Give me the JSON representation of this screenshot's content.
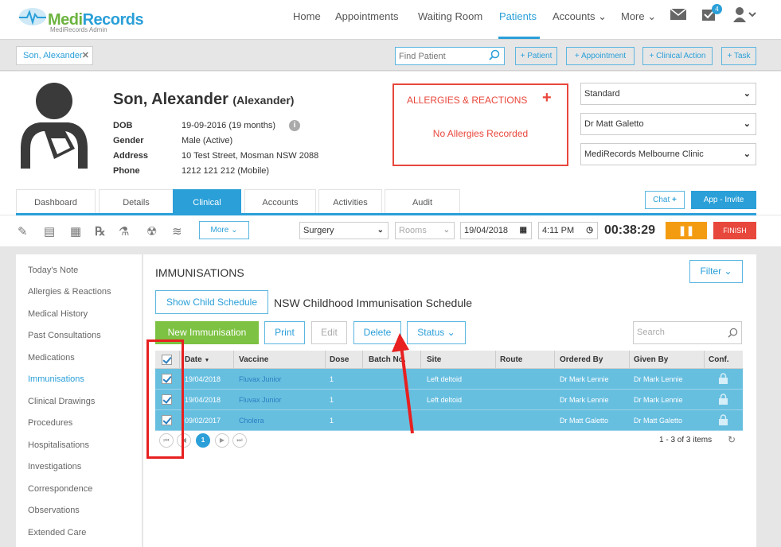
{
  "app": {
    "logo_primary": "Medi",
    "logo_secondary": "Records",
    "logo_sub": "MediRecords Admin"
  },
  "nav": {
    "items": [
      {
        "label": "Home"
      },
      {
        "label": "Appointments"
      },
      {
        "label": "Waiting Room"
      },
      {
        "label": "Patients"
      },
      {
        "label": "Accounts ⌄"
      },
      {
        "label": "More ⌄"
      }
    ],
    "active": "Patients",
    "notifications": "4"
  },
  "patientbar": {
    "open_tab": "Son, Alexander",
    "find_placeholder": "Find Patient",
    "buttons": [
      "+ Patient",
      "+ Appointment",
      "+ Clinical Action",
      "+ Task"
    ]
  },
  "patient": {
    "name": "Son, Alexander",
    "alias": "(Alexander)",
    "fields": [
      {
        "label": "DOB",
        "value": "19-09-2016 (19 months)"
      },
      {
        "label": "Gender",
        "value": "Male (Active)"
      },
      {
        "label": "Address",
        "value": "10 Test Street, Mosman NSW 2088"
      },
      {
        "label": "Phone",
        "value": "1212 121 212 (Mobile)"
      }
    ]
  },
  "allergies": {
    "title": "ALLERGIES & REACTIONS",
    "plus": "+",
    "empty": "No Allergies Recorded"
  },
  "selects": [
    "Standard",
    "Dr Matt Galetto",
    "MediRecords Melbourne Clinic"
  ],
  "tabs": [
    "Dashboard",
    "Details",
    "Clinical",
    "Accounts",
    "Activities",
    "Audit"
  ],
  "active_tab": "Clinical",
  "tab_actions": {
    "chat": "Chat",
    "app_invite": "App - Invite"
  },
  "toolbar": {
    "more": "More",
    "location": "Surgery",
    "rooms_placeholder": "Rooms",
    "date": "19/04/2018",
    "time": "4:11 PM",
    "timer": "00:38:29",
    "finish": "FINISH"
  },
  "leftnav": {
    "items": [
      "Today's Note",
      "Allergies & Reactions",
      "Medical History",
      "Past Consultations",
      "Medications",
      "Immunisations",
      "Clinical Drawings",
      "Procedures",
      "Hospitalisations",
      "Investigations",
      "Correspondence",
      "Observations",
      "Extended Care"
    ],
    "active": "Immunisations"
  },
  "immunisations": {
    "title": "IMMUNISATIONS",
    "filter": "Filter",
    "show_schedule": "Show Child Schedule",
    "schedule_name": "NSW Childhood Immunisation Schedule",
    "actions": {
      "new": "New Immunisation",
      "print": "Print",
      "edit": "Edit",
      "delete": "Delete",
      "status": "Status"
    },
    "search_placeholder": "Search",
    "columns": [
      "Date",
      "Vaccine",
      "Dose",
      "Batch No.",
      "Site",
      "Route",
      "Ordered By",
      "Given By",
      "Conf."
    ],
    "rows": [
      {
        "date": "19/04/2018",
        "vaccine": "Fluvax Junior",
        "dose": "1",
        "batch": "",
        "site": "Left deltoid",
        "route": "",
        "ordered_by": "Dr Mark Lennie",
        "given_by": "Dr Mark Lennie"
      },
      {
        "date": "19/04/2018",
        "vaccine": "Fluvax Junior",
        "dose": "1",
        "batch": "",
        "site": "Left deltoid",
        "route": "",
        "ordered_by": "Dr Mark Lennie",
        "given_by": "Dr Mark Lennie"
      },
      {
        "date": "09/02/2017",
        "vaccine": "Cholera",
        "dose": "1",
        "batch": "",
        "site": "",
        "route": "",
        "ordered_by": "Dr Matt Galetto",
        "given_by": "Dr Matt Galetto"
      }
    ],
    "pager": {
      "current": "1",
      "info": "1 - 3 of 3 items"
    }
  },
  "colors": {
    "accent": "#2a9fd8",
    "brand_green": "#6cb33f",
    "danger": "#e8473c",
    "warning": "#f39c12",
    "row_selected": "#67bfe0"
  }
}
